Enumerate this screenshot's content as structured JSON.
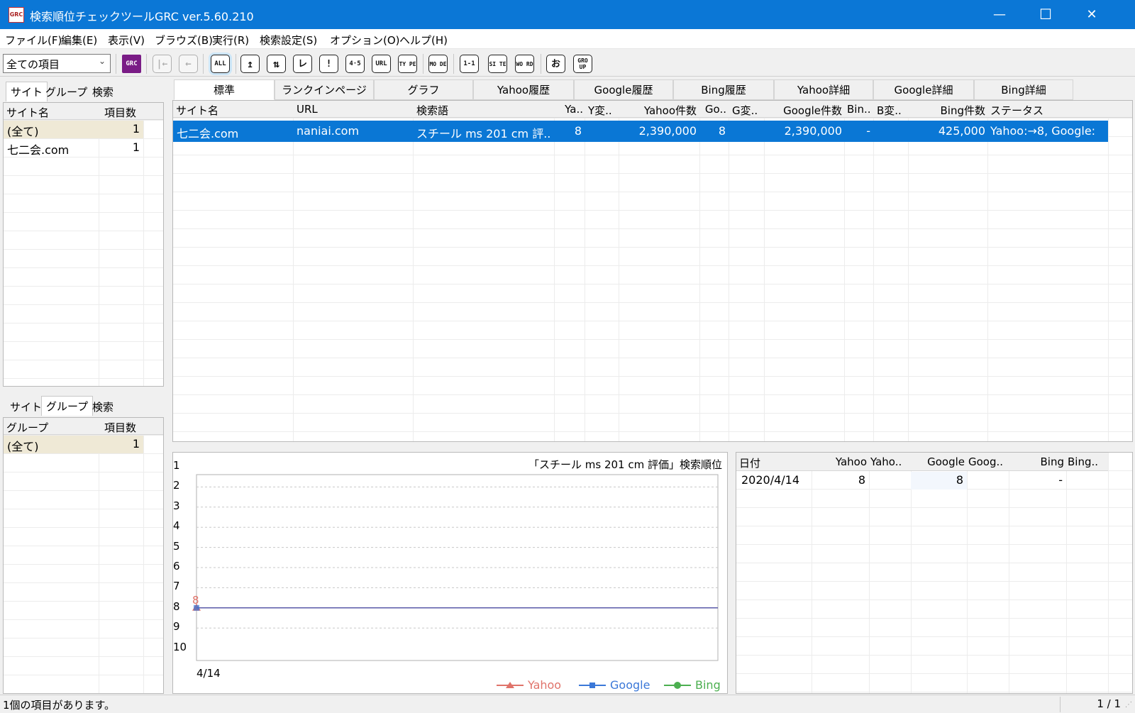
{
  "window": {
    "title": "検索順位チェックツールGRC  ver.5.60.210",
    "icon_text": "GRC",
    "min": "—",
    "max": "☐",
    "close": "✕"
  },
  "menu": [
    "ファイル(F)",
    "編集(E)",
    "表示(V)",
    "ブラウズ(B)",
    "実行(R)",
    "検索設定(S)",
    "オプション(O)",
    "ヘルプ(H)"
  ],
  "toolbar": {
    "filter_value": "全ての項目",
    "buttons": [
      "GRC",
      "|←",
      "←",
      "ALL",
      "↥",
      "⇅",
      "レ",
      "!",
      "4·5",
      "URL",
      "TY PE",
      "MO DE",
      "1-1",
      "SI TE",
      "WO RD",
      "お",
      "GRO UP"
    ]
  },
  "site_panel": {
    "tabs": [
      "サイト",
      "グループ",
      "検索"
    ],
    "headers": [
      "サイト名",
      "項目数"
    ],
    "rows": [
      {
        "name": "(全て)",
        "count": "1"
      },
      {
        "name": "七二会.com",
        "count": "1"
      }
    ]
  },
  "group_panel": {
    "tabs": [
      "サイト",
      "グループ",
      "検索"
    ],
    "headers": [
      "グループ",
      "項目数"
    ],
    "rows": [
      {
        "name": "(全て)",
        "count": "1"
      }
    ]
  },
  "main_tabs": [
    "標準",
    "ランクインページ",
    "グラフ",
    "Yahoo履歴",
    "Google履歴",
    "Bing履歴",
    "Yahoo詳細",
    "Google詳細",
    "Bing詳細"
  ],
  "table": {
    "headers": [
      "サイト名",
      "URL",
      "検索語",
      "Ya..",
      "Y変..",
      "Yahoo件数",
      "Go..",
      "G変..",
      "Google件数",
      "Bin..",
      "B変..",
      "Bing件数",
      "ステータス"
    ],
    "rows": [
      [
        "七二会.com",
        "naniai.com",
        "スチール ms 201 cm 評..",
        "8",
        "",
        "2,390,000",
        "8",
        "",
        "2,390,000",
        "-",
        "",
        "425,000",
        "Yahoo:→8, Google:"
      ]
    ]
  },
  "chart_data": {
    "type": "line",
    "title": "「スチール ms 201 cm 評価」検索順位",
    "categories": [
      "4/14"
    ],
    "ylim": [
      1,
      10
    ],
    "y_inverted": true,
    "yticks": [
      "1",
      "2",
      "3",
      "4",
      "5",
      "6",
      "7",
      "8",
      "9",
      "10"
    ],
    "series": [
      {
        "name": "Yahoo",
        "values": [
          8
        ],
        "color": "#e0736a"
      },
      {
        "name": "Google",
        "values": [
          8
        ],
        "color": "#3b78d8"
      },
      {
        "name": "Bing",
        "values": [
          null
        ],
        "color": "#4caf50"
      }
    ],
    "data_labels": [
      "8"
    ],
    "legend": "bottom-right",
    "grid": true
  },
  "history": {
    "headers": [
      "日付",
      "Yahoo",
      "Yaho..",
      "Google",
      "Goog..",
      "Bing",
      "Bing.."
    ],
    "rows": [
      [
        "2020/4/14",
        "8",
        "",
        "8",
        "",
        "-",
        ""
      ]
    ]
  },
  "status": {
    "left": "1個の項目があります。",
    "right": "1 / 1"
  }
}
